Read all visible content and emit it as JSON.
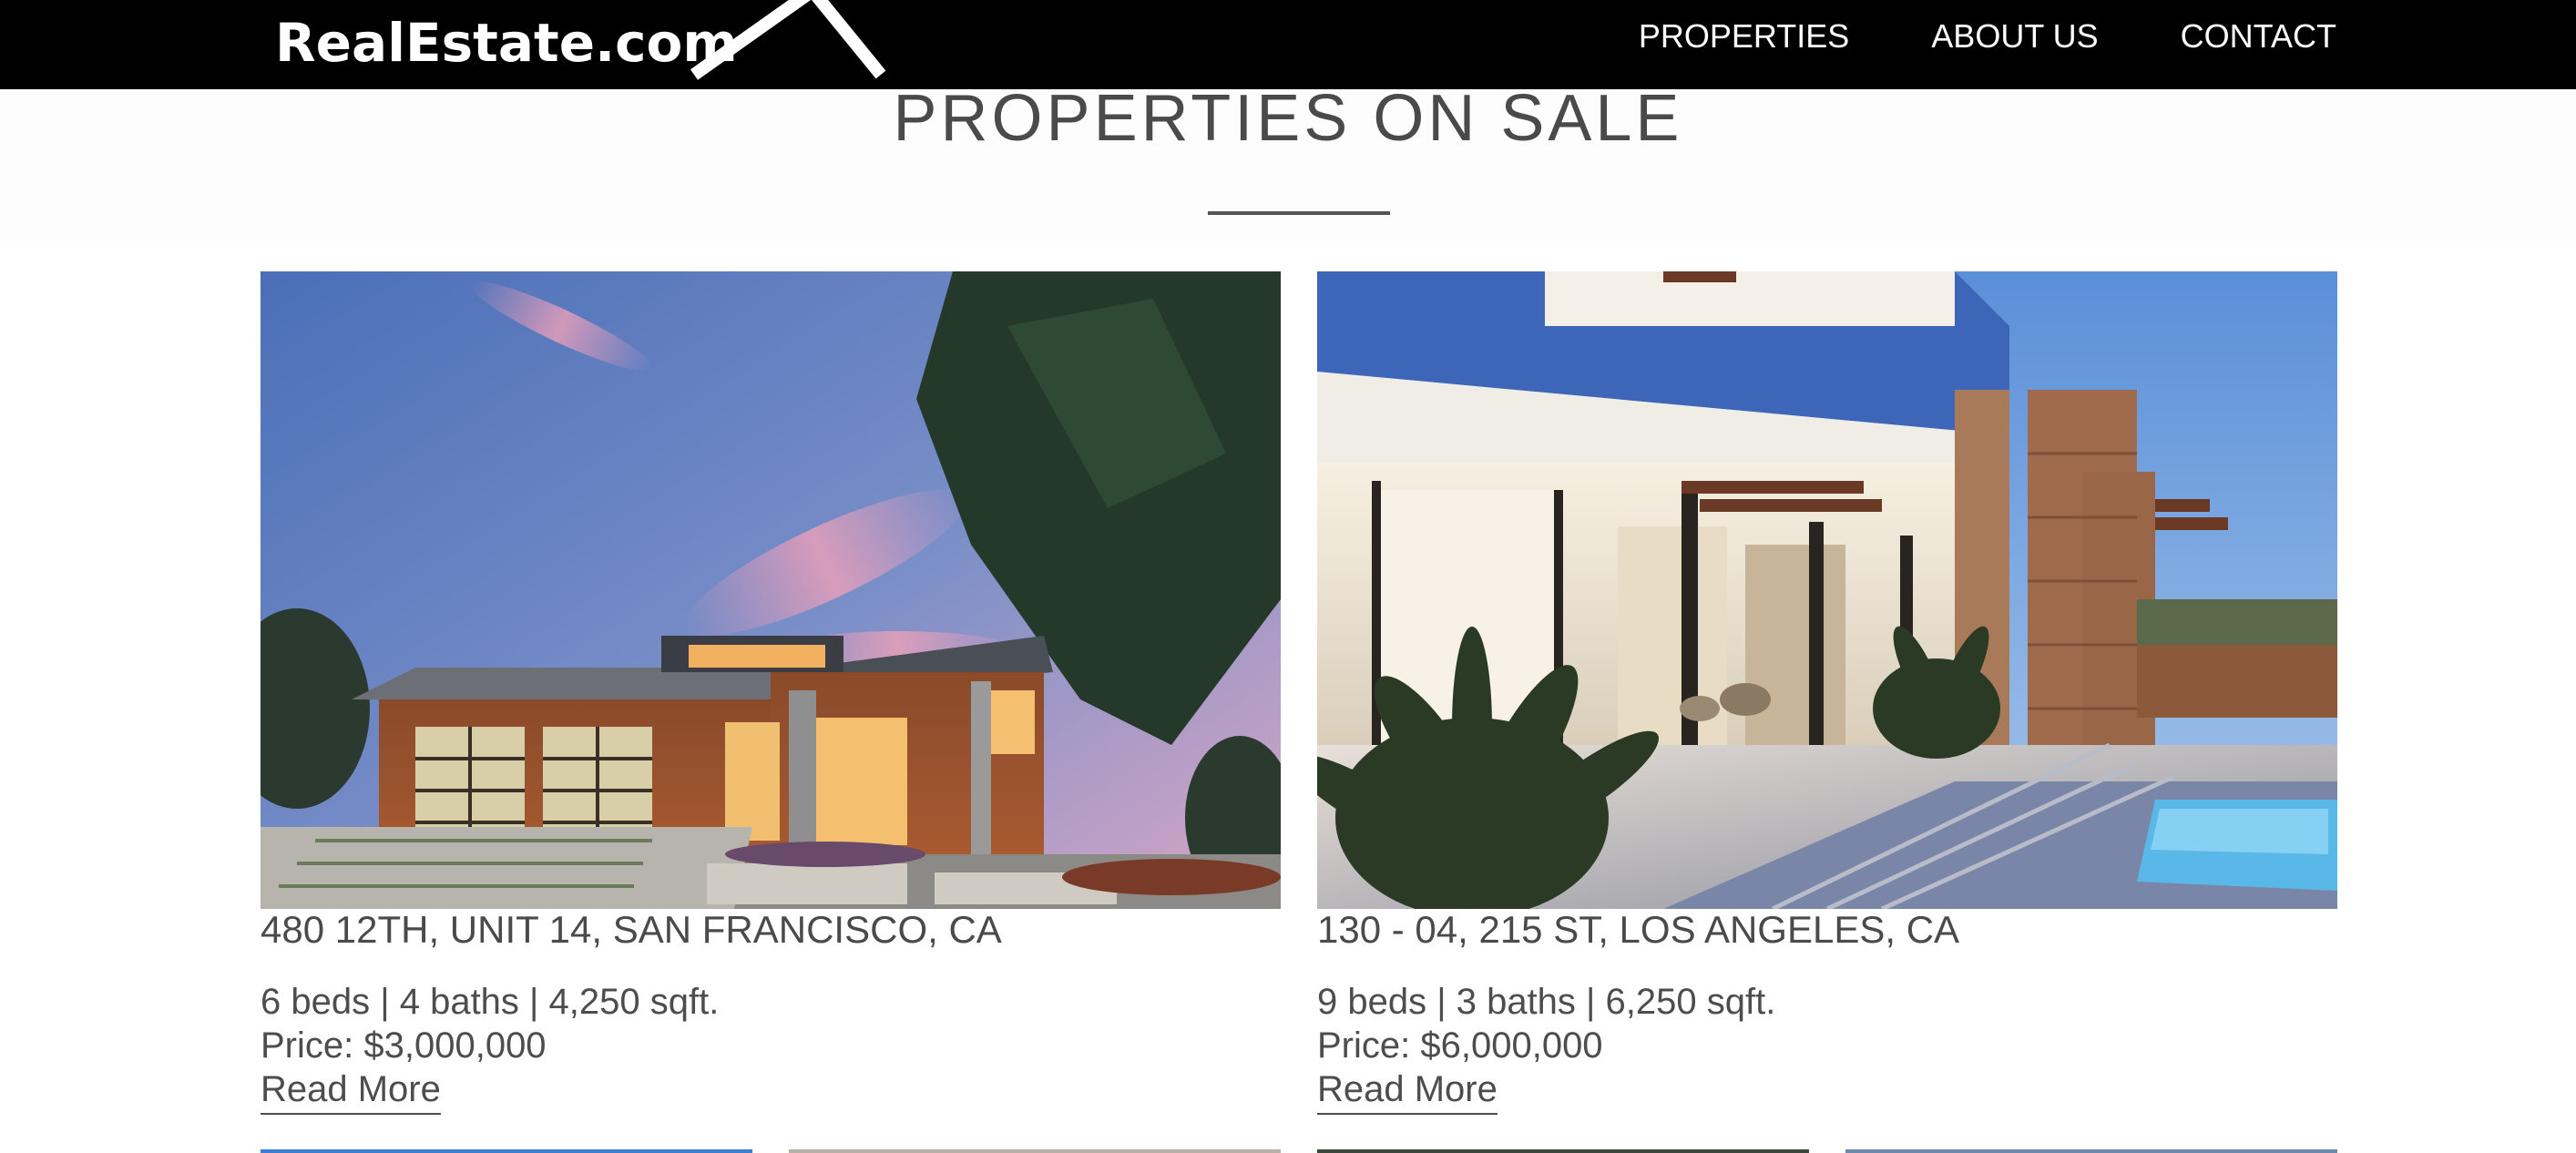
{
  "header": {
    "logo_text": "RealEstate.com",
    "nav": [
      {
        "label": "PROPERTIES"
      },
      {
        "label": "ABOUT US"
      },
      {
        "label": "CONTACT"
      }
    ]
  },
  "main": {
    "title": "PROPERTIES ON SALE",
    "listings": [
      {
        "address": "480 12TH, UNIT 14, SAN FRANCISCO, CA",
        "details": "6 beds | 4 baths | 4,250 sqft.",
        "price": "Price: $3,000,000",
        "link": "Read More"
      },
      {
        "address": "130 - 04, 215 ST, LOS ANGELES, CA",
        "details": "9 beds | 3 baths | 6,250 sqft.",
        "price": "Price: $6,000,000",
        "link": "Read More"
      }
    ]
  },
  "colors": {
    "nav_background": "#000000",
    "text": "#4a4a4a"
  }
}
